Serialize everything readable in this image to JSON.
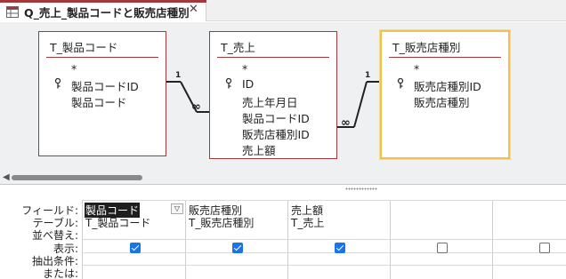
{
  "tab": {
    "title": "Q_売上_製品コードと販売店種別",
    "icon": "query-icon",
    "close_label": "✕"
  },
  "colors": {
    "tab_accent": "#a4373a",
    "table_border": "#a4373a",
    "active_table_border": "#f2c14b",
    "checkbox_on": "#1a73e8",
    "diagram_bg": "#eff0f2"
  },
  "diagram": {
    "tables": [
      {
        "name": "T_製品コード",
        "fields": [
          "*",
          "製品コードID",
          "製品コード"
        ],
        "key_field": "製品コードID"
      },
      {
        "name": "T_売上",
        "fields": [
          "*",
          "ID",
          "売上年月日",
          "製品コードID",
          "販売店種別ID",
          "売上額"
        ],
        "key_field": "ID"
      },
      {
        "name": "T_販売店種別",
        "fields": [
          "*",
          "販売店種別ID",
          "販売店種別"
        ],
        "key_field": "販売店種別ID",
        "selected": true
      }
    ],
    "relationships": [
      {
        "from": "T_製品コード.製品コードID",
        "to": "T_売上.製品コードID",
        "one_label": "1",
        "many_label": "∞"
      },
      {
        "from": "T_販売店種別.販売店種別ID",
        "to": "T_売上.販売店種別ID",
        "one_label": "1",
        "many_label": "∞"
      }
    ]
  },
  "grid": {
    "row_labels": [
      "フィールド:",
      "テーブル:",
      "並べ替え:",
      "表示:",
      "抽出条件:",
      "または:"
    ],
    "columns": [
      {
        "field": "製品コード",
        "table": "T_製品コード",
        "sort": "",
        "show": true,
        "criteria": "",
        "or": "",
        "field_selected": true
      },
      {
        "field": "販売店種別",
        "table": "T_販売店種別",
        "sort": "",
        "show": true,
        "criteria": "",
        "or": ""
      },
      {
        "field": "売上額",
        "table": "T_売上",
        "sort": "",
        "show": true,
        "criteria": "",
        "or": ""
      },
      {
        "field": "",
        "table": "",
        "sort": "",
        "show": false,
        "criteria": "",
        "or": ""
      },
      {
        "field": "",
        "table": "",
        "sort": "",
        "show": false,
        "criteria": "",
        "or": ""
      }
    ]
  }
}
